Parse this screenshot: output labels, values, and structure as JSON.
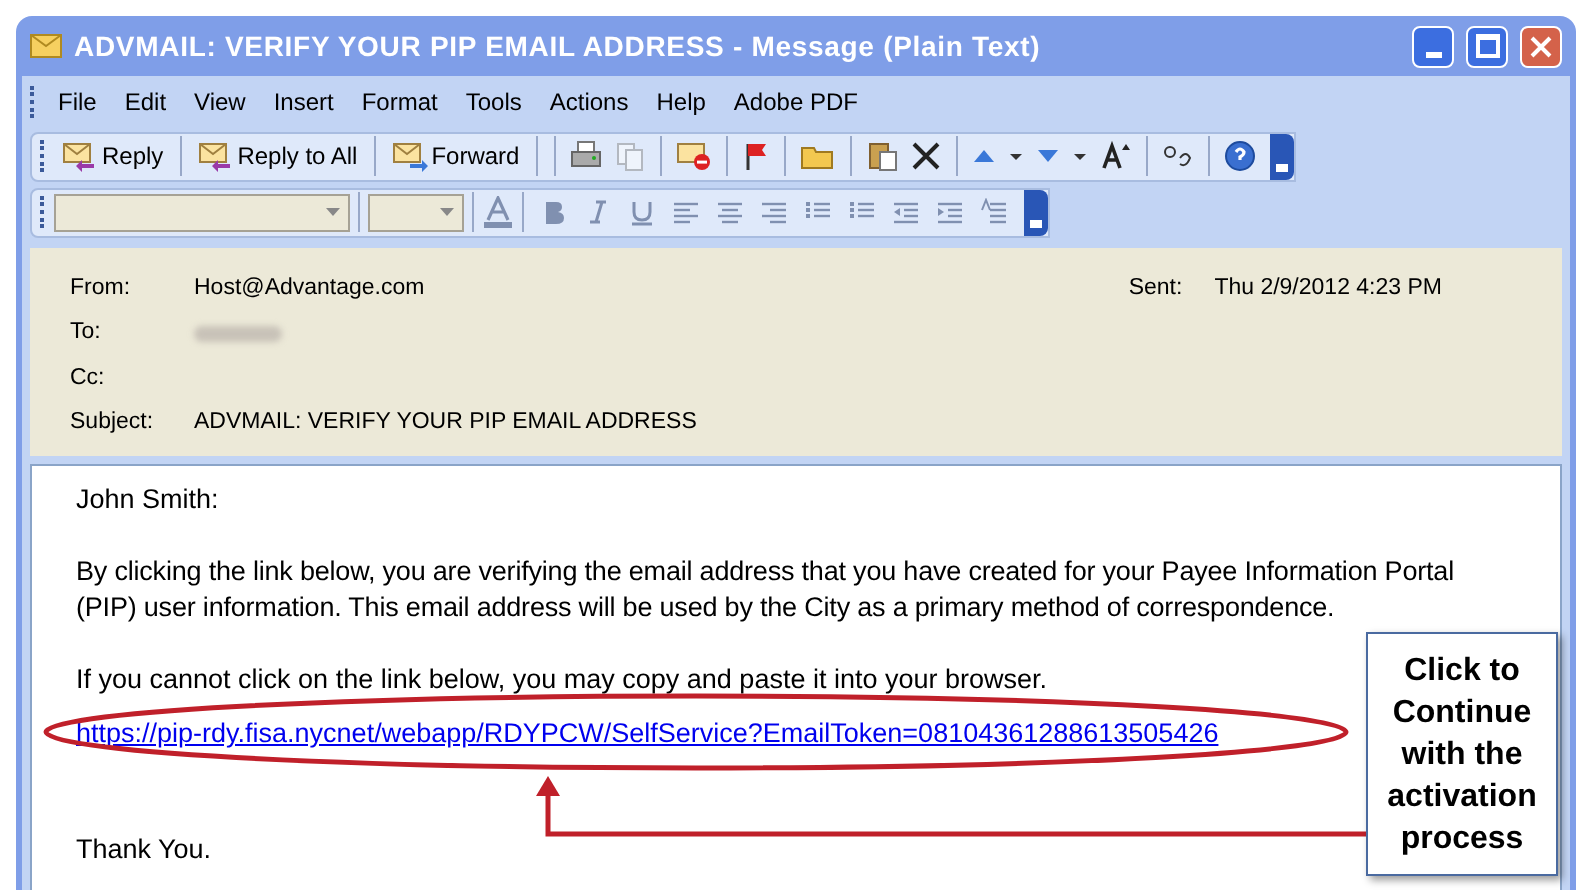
{
  "window": {
    "title": "ADVMAIL: VERIFY YOUR PIP EMAIL ADDRESS - Message (Plain Text)"
  },
  "menu": [
    "File",
    "Edit",
    "View",
    "Insert",
    "Format",
    "Tools",
    "Actions",
    "Help",
    "Adobe PDF"
  ],
  "toolbar": [
    "Reply",
    "Reply to All",
    "Forward"
  ],
  "header": {
    "from_label": "From:",
    "from": "Host@Advantage.com",
    "sent_label": "Sent:",
    "sent": "Thu 2/9/2012 4:23 PM",
    "to_label": "To:",
    "cc_label": "Cc:",
    "subject_label": "Subject:",
    "subject": "ADVMAIL: VERIFY YOUR PIP EMAIL ADDRESS"
  },
  "body": {
    "greeting": "John Smith:",
    "paragraph_1": "By clicking the link below, you are verifying the email address that you have created for your Payee Information Portal (PIP) user information. This email address will be used by the City as a primary method of correspondence.",
    "paragraph_2": "If you cannot click on the link below, you may copy and paste it into your browser.",
    "link": "https://pip-rdy.fisa.nycnet/webapp/RDYPCW/SelfService?EmailToken=08104361288613505426",
    "closing": "Thank You."
  },
  "callout": "Click to Continue with the activation process"
}
